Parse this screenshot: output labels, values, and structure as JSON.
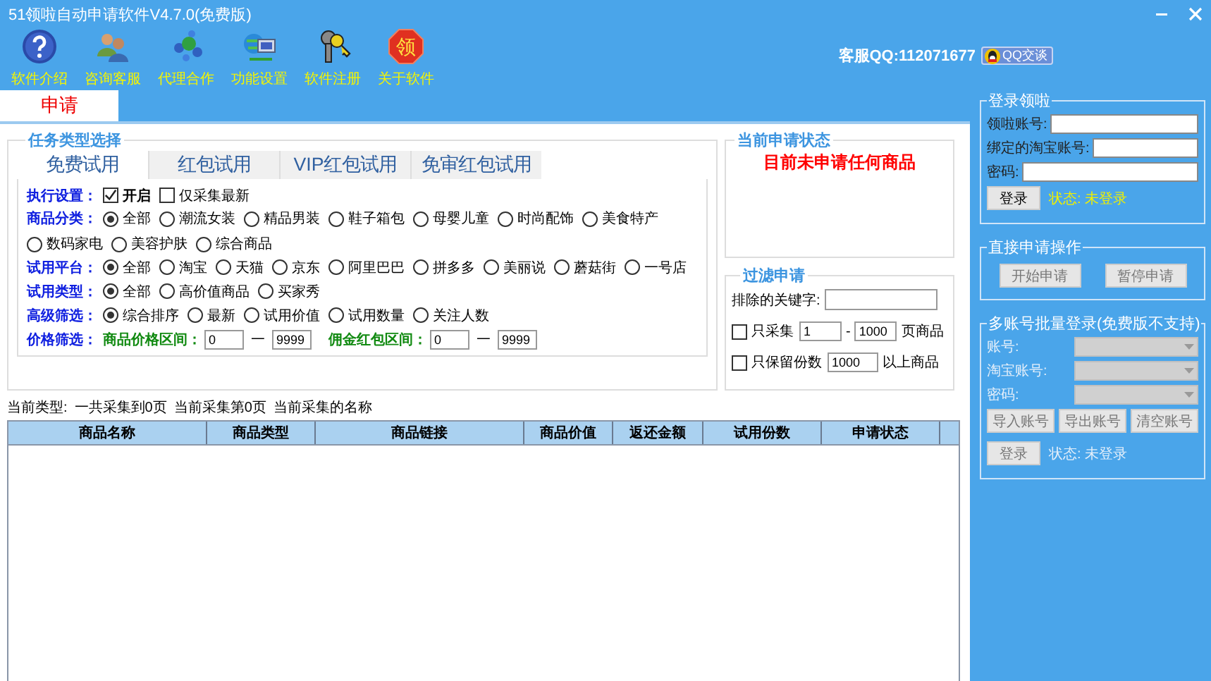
{
  "window": {
    "title": "51领啦自动申请软件V4.7.0(免费版)"
  },
  "toolbar": [
    {
      "label": "软件介绍"
    },
    {
      "label": "咨询客服"
    },
    {
      "label": "代理合作"
    },
    {
      "label": "功能设置"
    },
    {
      "label": "软件注册"
    },
    {
      "label": "关于软件",
      "glyph": "领"
    }
  ],
  "support": {
    "text": "客服QQ:112071677",
    "button": "QQ交谈"
  },
  "tabs": [
    {
      "label": "申请",
      "selected": true
    }
  ],
  "task_group": {
    "title": "任务类型选择",
    "tabs": [
      {
        "label": "免费试用",
        "selected": true
      },
      {
        "label": "红包试用",
        "selected": false
      },
      {
        "label": "VIP红包试用",
        "selected": false
      },
      {
        "label": "免审红包试用",
        "selected": false
      }
    ],
    "rows": [
      {
        "kind": "check",
        "label": "执行设置：",
        "options": [
          {
            "label": "开启",
            "checked": true,
            "bold": true
          },
          {
            "label": "仅采集最新",
            "checked": false,
            "bold": false
          }
        ]
      },
      {
        "kind": "radio",
        "label": "商品分类：",
        "options": [
          {
            "label": "全部",
            "selected": true
          },
          {
            "label": "潮流女装",
            "selected": false
          },
          {
            "label": "精品男装",
            "selected": false
          },
          {
            "label": "鞋子箱包",
            "selected": false
          },
          {
            "label": "母婴儿童",
            "selected": false
          },
          {
            "label": "时尚配饰",
            "selected": false
          },
          {
            "label": "美食特产",
            "selected": false
          },
          {
            "label": "数码家电",
            "selected": false
          },
          {
            "label": "美容护肤",
            "selected": false
          },
          {
            "label": "综合商品",
            "selected": false
          }
        ]
      },
      {
        "kind": "radio",
        "label": "试用平台：",
        "options": [
          {
            "label": "全部",
            "selected": true
          },
          {
            "label": "淘宝",
            "selected": false
          },
          {
            "label": "天猫",
            "selected": false
          },
          {
            "label": "京东",
            "selected": false
          },
          {
            "label": "阿里巴巴",
            "selected": false
          },
          {
            "label": "拼多多",
            "selected": false
          },
          {
            "label": "美丽说",
            "selected": false
          },
          {
            "label": "蘑菇街",
            "selected": false
          },
          {
            "label": "一号店",
            "selected": false
          }
        ]
      },
      {
        "kind": "radio",
        "label": "试用类型：",
        "options": [
          {
            "label": "全部",
            "selected": true
          },
          {
            "label": "高价值商品",
            "selected": false
          },
          {
            "label": "买家秀",
            "selected": false
          }
        ]
      },
      {
        "kind": "radio",
        "label": "高级筛选：",
        "options": [
          {
            "label": "综合排序",
            "selected": true
          },
          {
            "label": "最新",
            "selected": false
          },
          {
            "label": "试用价值",
            "selected": false
          },
          {
            "label": "试用数量",
            "selected": false
          },
          {
            "label": "关注人数",
            "selected": false
          }
        ]
      },
      {
        "kind": "range",
        "label": "价格筛选：",
        "ranges": [
          {
            "label": "商品价格区间：",
            "from": "0",
            "separator": "一",
            "to": "9999"
          },
          {
            "label": "佣金红包区间：",
            "from": "0",
            "separator": "一",
            "to": "9999"
          }
        ]
      }
    ]
  },
  "status_panel": {
    "title": "当前申请状态",
    "message": "目前未申请任何商品"
  },
  "filter": {
    "title": "过滤申请",
    "keyword_label": "排除的关键字:",
    "pages": {
      "checked": false,
      "label": "只采集",
      "from": "1",
      "separator": "-",
      "to": "1000",
      "suffix": "页商品"
    },
    "keep": {
      "checked": false,
      "label": "只保留份数",
      "value": "1000",
      "suffix": "以上商品"
    }
  },
  "status_line": [
    "当前类型:",
    "一共采集到0页",
    "当前采集第0页",
    "当前采集的名称"
  ],
  "table": {
    "columns": [
      "商品名称",
      "商品类型",
      "商品链接",
      "商品价值",
      "返还金额",
      "试用份数",
      "申请状态"
    ]
  },
  "login": {
    "title": "登录领啦",
    "fields": [
      {
        "label": "领啦账号:"
      },
      {
        "label": "绑定的淘宝账号:"
      },
      {
        "label": "密码:"
      }
    ],
    "button": "登录",
    "status": "状态: 未登录"
  },
  "direct": {
    "title": "直接申请操作",
    "buttons": [
      {
        "label": "开始申请",
        "disabled": true
      },
      {
        "label": "暂停申请",
        "disabled": true
      }
    ]
  },
  "batch": {
    "title": "多账号批量登录(免费版不支持)",
    "disabled": true,
    "fields": [
      {
        "label": "账号:"
      },
      {
        "label": "淘宝账号:"
      },
      {
        "label": "密码:"
      }
    ],
    "buttons": [
      "导入账号",
      "导出账号",
      "清空账号"
    ],
    "button": "登录",
    "status": "状态: 未登录"
  }
}
